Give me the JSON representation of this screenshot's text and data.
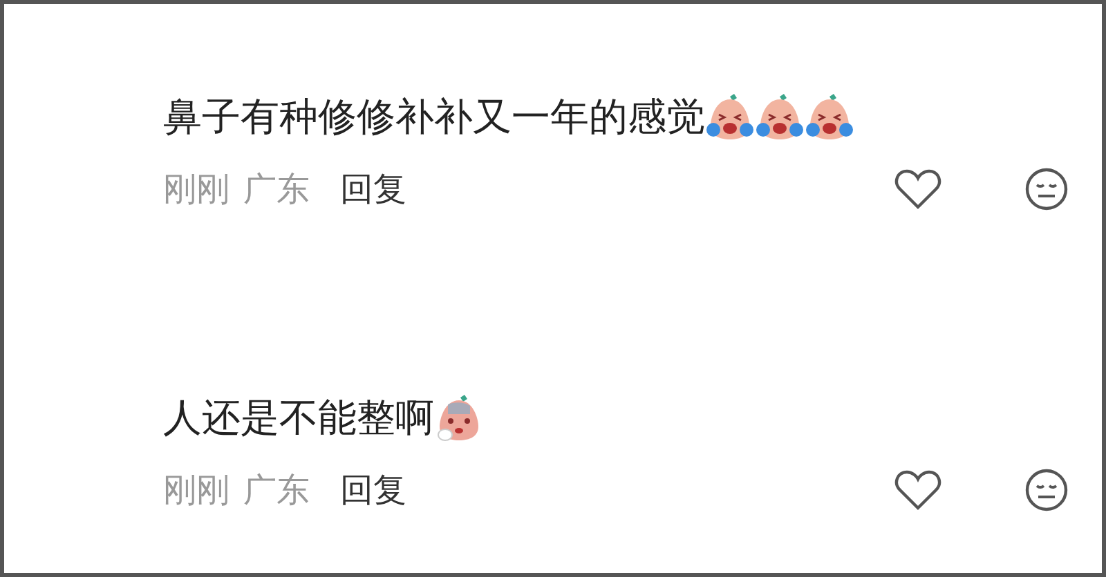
{
  "comments": [
    {
      "text": "鼻子有种修修补补又一年的感觉",
      "emojis": [
        {
          "kind": "crying"
        },
        {
          "kind": "crying"
        },
        {
          "kind": "crying"
        }
      ],
      "time": "刚刚",
      "location": "广东",
      "reply": "回复"
    },
    {
      "text": "人还是不能整啊",
      "emojis": [
        {
          "kind": "sad"
        }
      ],
      "time": "刚刚",
      "location": "广东",
      "reply": "回复"
    }
  ]
}
